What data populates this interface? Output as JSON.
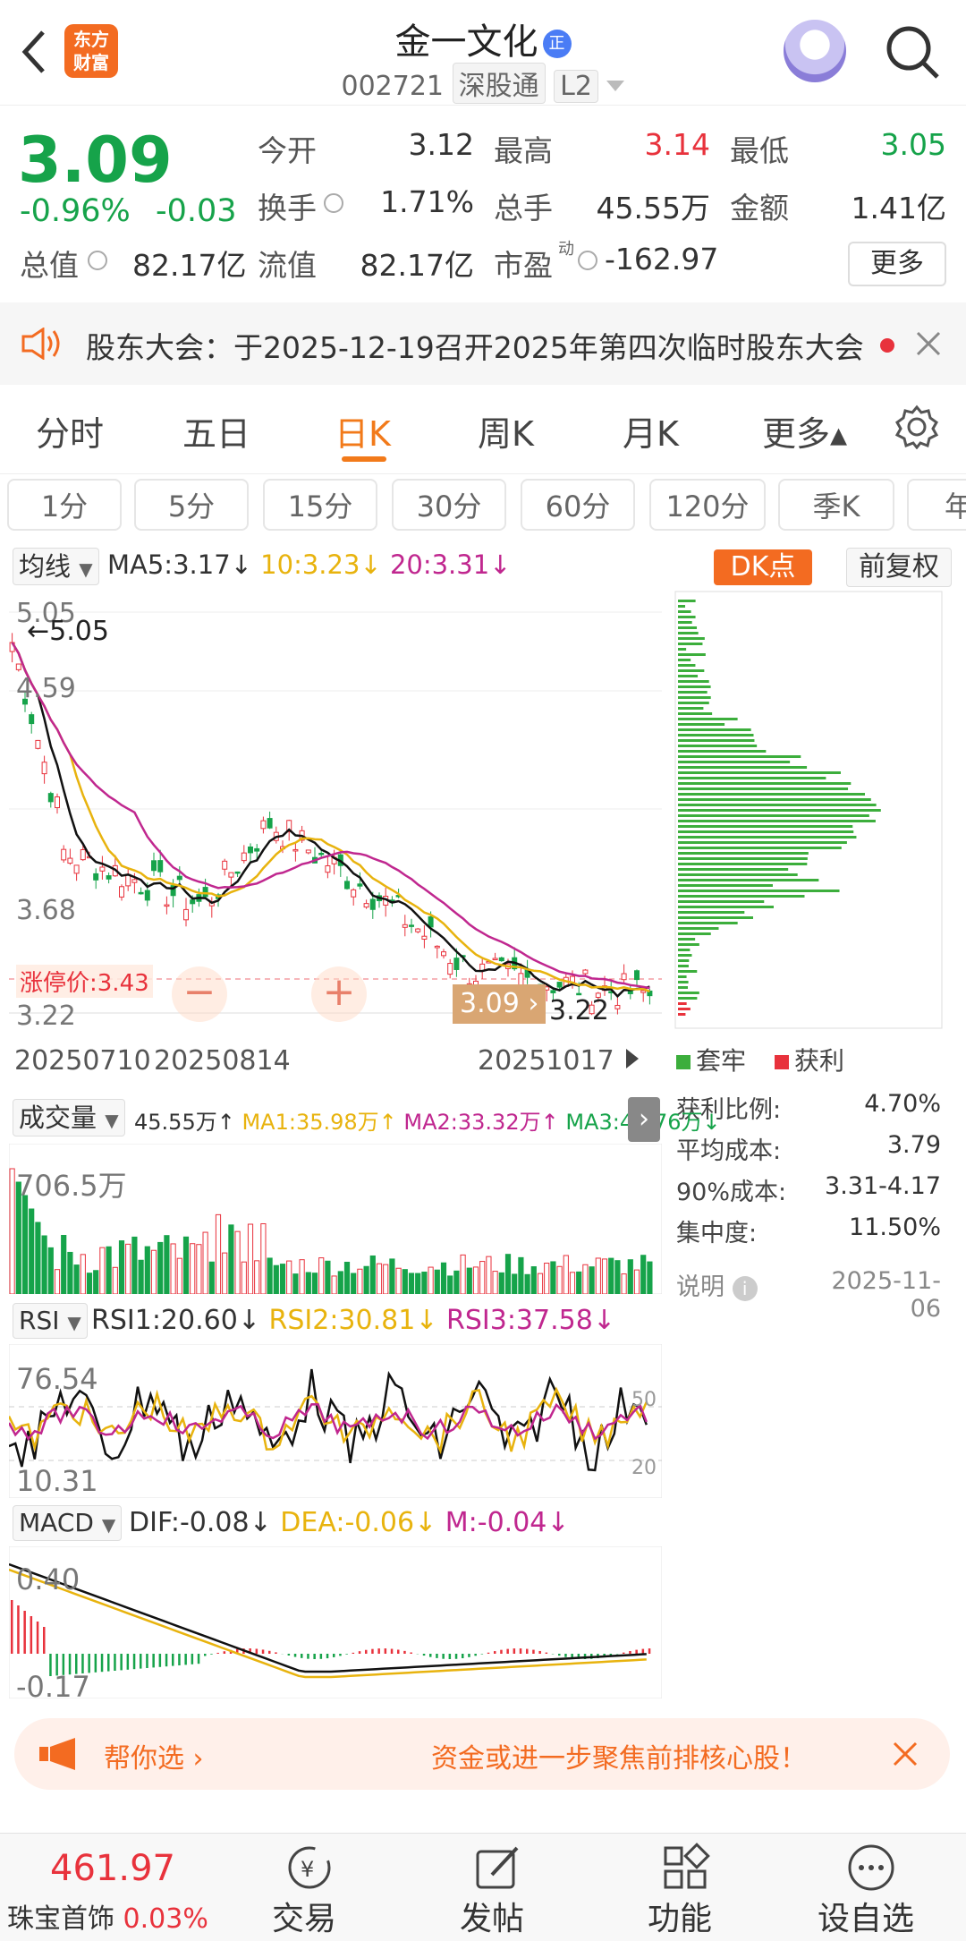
{
  "header": {
    "logo_line1": "东方",
    "logo_line2": "财富",
    "stock_name": "金一文化",
    "badge": "正",
    "code": "002721",
    "market": "深股通",
    "level": "L2"
  },
  "quote": {
    "price": "3.09",
    "change_pct": "-0.96%",
    "change": "-0.03",
    "open_label": "今开",
    "open": "3.12",
    "high_label": "最高",
    "high": "3.14",
    "low_label": "最低",
    "low": "3.05",
    "turnover_label": "换手",
    "turnover": "1.71%",
    "volume_label": "总手",
    "volume": "45.55万",
    "amount_label": "金额",
    "amount": "1.41亿",
    "mktcap_label": "总值",
    "mktcap": "82.17亿",
    "float_label": "流值",
    "float": "82.17亿",
    "pe_label": "市盈",
    "pe_sup": "动",
    "pe": "-162.97",
    "more": "更多"
  },
  "notice": {
    "text": "股东大会：于2025-12-19召开2025年第四次临时股东大会"
  },
  "tabs": [
    "分时",
    "五日",
    "日K",
    "周K",
    "月K",
    "更多▴"
  ],
  "periods": [
    "1分",
    "5分",
    "15分",
    "30分",
    "60分",
    "120分",
    "季K",
    "年"
  ],
  "ma": {
    "selector": "均线",
    "ma5": "MA5:3.17↓",
    "ma10": "10:3.23↓",
    "ma20": "20:3.31↓",
    "dk": "DK点",
    "fq": "前复权"
  },
  "kline": {
    "y_top": "5.05",
    "y_mid": "4.59",
    "y_low": "3.68",
    "y_bot": "3.22",
    "max_label": "5.05",
    "limit_label": "涨停价:3.43",
    "price_tag": "3.09",
    "min_label": "3.22",
    "dates": [
      "20250710",
      "20250814",
      "20251017"
    ]
  },
  "volume": {
    "selector": "成交量",
    "total": "45.55万↑",
    "ma1": "MA1:35.98万↑",
    "ma2": "MA2:33.32万↑",
    "ma3": "MA3:40.76万↓",
    "y_top": "706.5万"
  },
  "rsi": {
    "selector": "RSI",
    "rsi1": "RSI1:20.60↓",
    "rsi2": "RSI2:30.81↓",
    "rsi3": "RSI3:37.58↓",
    "y_top": "76.54",
    "y_bot": "10.31",
    "l50": "50",
    "l20": "20"
  },
  "macd": {
    "selector": "MACD",
    "dif": "DIF:-0.08↓",
    "dea": "DEA:-0.06↓",
    "m": "M:-0.04↓",
    "y_top": "0.40",
    "y_bot": "-0.17"
  },
  "chip": {
    "legend_trap": "套牢",
    "legend_profit": "获利",
    "rows": [
      {
        "k": "获利比例:",
        "v": "4.70%"
      },
      {
        "k": "平均成本:",
        "v": "3.79"
      },
      {
        "k": "90%成本:",
        "v": "3.31-4.17"
      },
      {
        "k": "集中度:",
        "v": "11.50%"
      }
    ],
    "note": "说明",
    "date": "2025-11-06"
  },
  "banner": {
    "left": "帮你选",
    "text": "资金或进一步聚焦前排核心股！"
  },
  "bottom": {
    "index_value": "461.97",
    "index_name": "珠宝首饰",
    "index_pct": "0.03%",
    "items": [
      "交易",
      "发帖",
      "功能",
      "设自选"
    ]
  }
}
